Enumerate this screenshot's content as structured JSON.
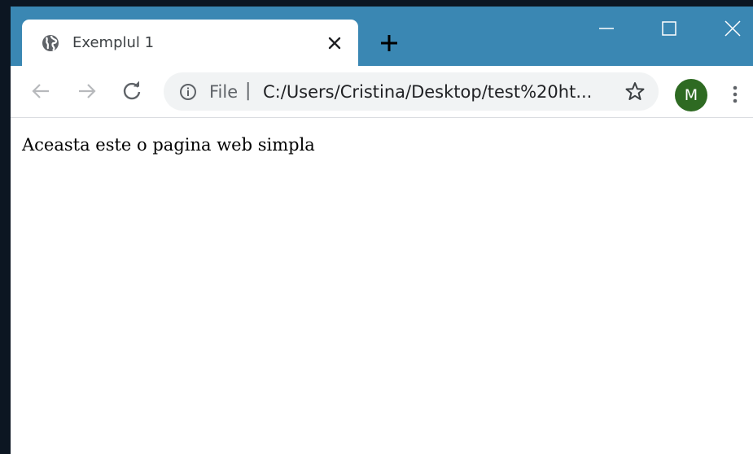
{
  "browser": {
    "tab": {
      "title": "Exemplul 1",
      "favicon_icon": "globe-icon",
      "close_icon": "close-icon"
    },
    "new_tab_icon": "plus-icon",
    "window_controls": [
      "minimize-icon",
      "maximize-icon",
      "close-icon"
    ],
    "toolbar": {
      "back_icon": "arrow-left-icon",
      "forward_icon": "arrow-right-icon",
      "reload_icon": "reload-icon",
      "omnibox": {
        "info_icon": "info-icon",
        "scheme_label": "File",
        "separator": "|",
        "url": "C:/Users/Cristina/Desktop/test%20ht..."
      },
      "bookmark_icon": "star-icon",
      "profile_initial": "M",
      "menu_icon": "more-vert-icon"
    },
    "colors": {
      "titlebar": "#3a87b3",
      "avatar": "#2e6a22"
    }
  },
  "page": {
    "body_text": "Aceasta este o pagina web simpla"
  }
}
